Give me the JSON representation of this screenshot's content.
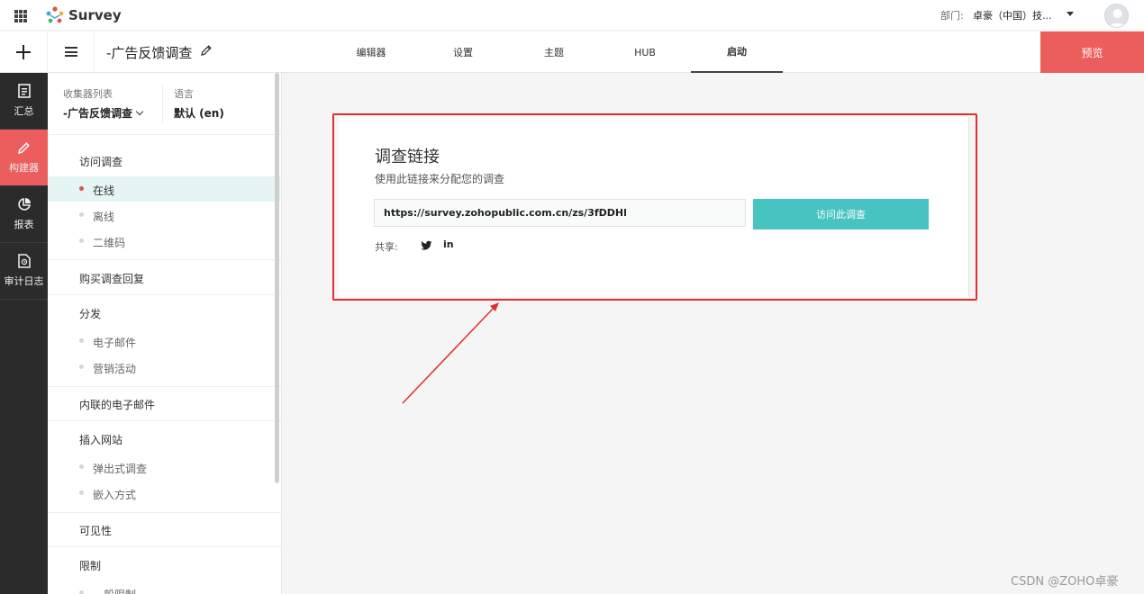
{
  "header": {
    "app_name": "Survey",
    "department_label": "部门:",
    "department_value": "卓豪（中国）技..."
  },
  "toolbar": {
    "survey_title": "-广告反馈调查",
    "tabs": [
      {
        "label": "编辑器",
        "active": false
      },
      {
        "label": "设置",
        "active": false
      },
      {
        "label": "主题",
        "active": false
      },
      {
        "label": "HUB",
        "active": false
      },
      {
        "label": "启动",
        "active": true
      }
    ],
    "preview_label": "预览"
  },
  "rail": {
    "items": [
      {
        "label": "汇总",
        "icon": "summary-icon",
        "active": false
      },
      {
        "label": "构建器",
        "icon": "pencil-icon",
        "active": true
      },
      {
        "label": "报表",
        "icon": "pie-chart-icon",
        "active": false
      },
      {
        "label": "审计日志",
        "icon": "audit-log-icon",
        "active": false
      }
    ]
  },
  "panel": {
    "collector_list_label": "收集器列表",
    "collector_value": "-广告反馈调查",
    "language_label": "语言",
    "language_value": "默认 (en)",
    "sections": {
      "visit": "访问调查",
      "visit_online": "在线",
      "visit_offline": "离线",
      "visit_qr": "二维码",
      "purchase": "购买调查回复",
      "distribute": "分发",
      "dist_email": "电子邮件",
      "dist_campaign": "营销活动",
      "inline_email": "内联的电子邮件",
      "embed_site": "插入网站",
      "embed_popup": "弹出式调查",
      "embed_method": "嵌入方式",
      "visibility": "可见性",
      "limits": "限制",
      "limits_general": "一般限制"
    }
  },
  "card": {
    "title": "调查链接",
    "description": "使用此链接来分配您的调查",
    "link": "https://survey.zohopublic.com.cn/zs/3fDDHl",
    "visit_button": "访问此调查",
    "share_label": "共享:",
    "linkedin_text": "in"
  },
  "colors": {
    "accent_red": "#ec5e5e",
    "teal": "#47c4c1",
    "highlight_red": "#e02f2f",
    "rail_bg": "#2b2b2b"
  },
  "watermark": "CSDN @ZOHO卓豪"
}
